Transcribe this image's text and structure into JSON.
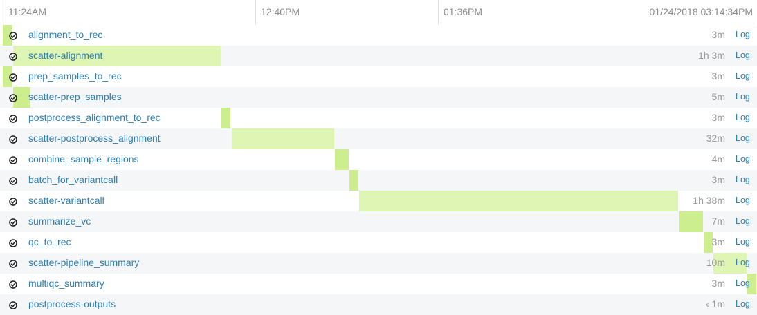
{
  "axis_ticks": [
    {
      "label": "11:24AM",
      "pos": 0.0
    },
    {
      "label": "12:40PM",
      "pos": 0.336
    },
    {
      "label": "01:36PM",
      "pos": 0.58
    },
    {
      "label": "01/24/2018 03:14:34PM",
      "pos": 1.0
    }
  ],
  "colors": {
    "bar": "#dff5b3",
    "bar_strong": "#cdee8f",
    "link": "#2c7fb8",
    "row_alt": "#f5f6f8"
  },
  "status_icon": "check-circle-icon",
  "log_label": "Log",
  "tasks": [
    {
      "name": "alignment_to_rec",
      "duration": "3m",
      "start_frac": 0.0,
      "end_frac": 0.013
    },
    {
      "name": "scatter-alignment",
      "duration": "1h 3m",
      "start_frac": 0.014,
      "end_frac": 0.289
    },
    {
      "name": "prep_samples_to_rec",
      "duration": "3m",
      "start_frac": 0.0,
      "end_frac": 0.013
    },
    {
      "name": "scatter-prep_samples",
      "duration": "5m",
      "start_frac": 0.014,
      "end_frac": 0.037
    },
    {
      "name": "postprocess_alignment_to_rec",
      "duration": "3m",
      "start_frac": 0.29,
      "end_frac": 0.302
    },
    {
      "name": "scatter-postprocess_alignment",
      "duration": "32m",
      "start_frac": 0.304,
      "end_frac": 0.44
    },
    {
      "name": "combine_sample_regions",
      "duration": "4m",
      "start_frac": 0.441,
      "end_frac": 0.459
    },
    {
      "name": "batch_for_variantcall",
      "duration": "3m",
      "start_frac": 0.46,
      "end_frac": 0.472
    },
    {
      "name": "scatter-variantcall",
      "duration": "1h 38m",
      "start_frac": 0.473,
      "end_frac": 0.896
    },
    {
      "name": "summarize_vc",
      "duration": "7m",
      "start_frac": 0.897,
      "end_frac": 0.929
    },
    {
      "name": "qc_to_rec",
      "duration": "3m",
      "start_frac": 0.93,
      "end_frac": 0.942
    },
    {
      "name": "scatter-pipeline_summary",
      "duration": "10m",
      "start_frac": 0.943,
      "end_frac": 0.987
    },
    {
      "name": "multiqc_summary",
      "duration": "3m",
      "start_frac": 0.988,
      "end_frac": 1.0
    },
    {
      "name": "postprocess-outputs",
      "duration": "‹ 1m",
      "start_frac": 1.0,
      "end_frac": 1.0
    }
  ]
}
